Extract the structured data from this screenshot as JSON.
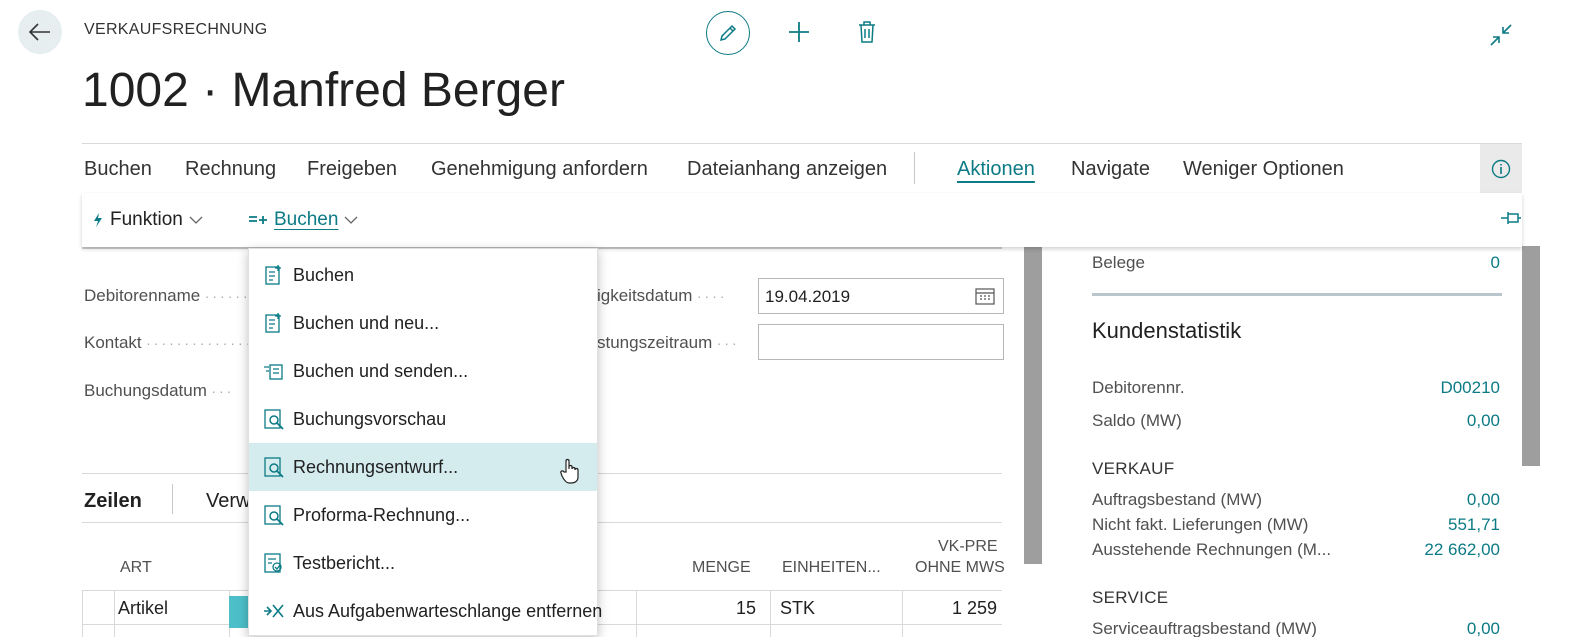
{
  "header": {
    "page_kind": "VERKAUFSRECHNUNG",
    "title": "1002 · Manfred Berger"
  },
  "actionbar": {
    "items": [
      "Buchen",
      "Rechnung",
      "Freigeben",
      "Genehmigung anfordern",
      "Dateianhang anzeigen",
      "Aktionen",
      "Navigate",
      "Weniger Optionen"
    ],
    "active": "Aktionen"
  },
  "subbar": {
    "funktion": "Funktion",
    "buchen": "Buchen"
  },
  "dropdown": {
    "items": [
      "Buchen",
      "Buchen und neu...",
      "Buchen und senden...",
      "Buchungsvorschau",
      "Rechnungsentwurf...",
      "Proforma-Rechnung...",
      "Testbericht...",
      "Aus Aufgabenwarteschlange entfernen"
    ],
    "hover_index": 4
  },
  "form": {
    "debitorenname_label": "Debitorenname",
    "kontakt_label": "Kontakt",
    "buchungsdatum_label": "Buchungsdatum",
    "faelligkeit_label": "igkeitsdatum",
    "leistung_label": "stungszeitraum",
    "faelligkeit_value": "19.04.2019",
    "leistung_value": ""
  },
  "lines": {
    "tab_active": "Zeilen",
    "tab_other": "Verw",
    "columns": {
      "art": "ART",
      "menge": "MENGE",
      "einheiten": "EINHEITEN...",
      "vk_preis_1": "VK-PRE",
      "vk_preis_2": "OHNE MWS"
    },
    "row": {
      "art": "Artikel",
      "menge": "15",
      "einheit": "STK",
      "vk_preis": "1 259"
    }
  },
  "factbox": {
    "belege_label": "Belege",
    "belege_value": "0",
    "title": "Kundenstatistik",
    "debitorennr_label": "Debitorennr.",
    "debitorennr_value": "D00210",
    "saldo_label": "Saldo (MW)",
    "saldo_value": "0,00",
    "verkauf_section": "VERKAUF",
    "auftragsbestand_label": "Auftragsbestand (MW)",
    "auftragsbestand_value": "0,00",
    "nicht_fakt_label": "Nicht fakt. Lieferungen (MW)",
    "nicht_fakt_value": "551,71",
    "ausstehende_label": "Ausstehende Rechnungen (M...",
    "ausstehende_value": "22 662,00",
    "service_section": "SERVICE",
    "serviceauftrag_label": "Serviceauftragsbestand (MW)",
    "serviceauftrag_value": "0,00"
  },
  "colors": {
    "accent": "#0c7b85",
    "hover_row": "#d5ecef",
    "selected_cell": "#4dbfc9"
  }
}
